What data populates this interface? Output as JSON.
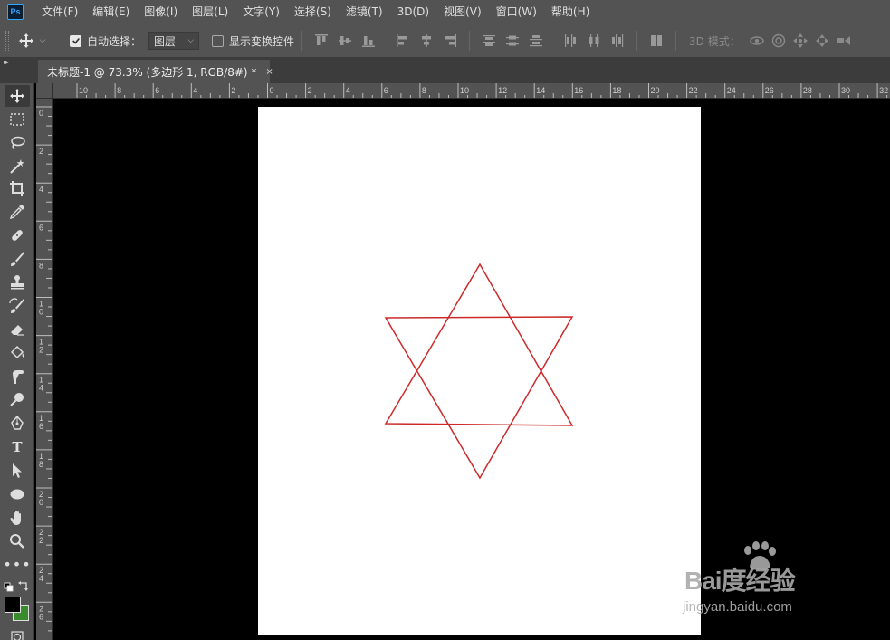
{
  "app": {
    "logo_text": "Ps"
  },
  "menu": [
    {
      "label": "文件(F)"
    },
    {
      "label": "编辑(E)"
    },
    {
      "label": "图像(I)"
    },
    {
      "label": "图层(L)"
    },
    {
      "label": "文字(Y)"
    },
    {
      "label": "选择(S)"
    },
    {
      "label": "滤镜(T)"
    },
    {
      "label": "3D(D)"
    },
    {
      "label": "视图(V)"
    },
    {
      "label": "窗口(W)"
    },
    {
      "label": "帮助(H)"
    }
  ],
  "options": {
    "auto_select_label": "自动选择：",
    "auto_select_checked": true,
    "auto_select_target": "图层",
    "show_transform_label": "显示变换控件",
    "show_transform_checked": false,
    "mode_3d_label": "3D 模式："
  },
  "document_tab": {
    "title": "未标题-1 @ 73.3% (多边形 1, RGB/8#) *",
    "close": "×"
  },
  "ruler": {
    "horizontal_labels": [
      "10",
      "8",
      "6",
      "4",
      "2",
      "0",
      "2",
      "4",
      "6",
      "8",
      "10",
      "12",
      "14",
      "16",
      "18",
      "20",
      "22",
      "24",
      "26",
      "28",
      "30",
      "32"
    ],
    "vertical_labels": [
      "0",
      "2",
      "4",
      "6",
      "8",
      "10",
      "12",
      "14",
      "16",
      "18",
      "20",
      "22",
      "24",
      "26"
    ]
  },
  "canvas": {
    "background": "#000000",
    "document_fill": "#ffffff",
    "shape": {
      "type": "hexagram",
      "stroke_color": "#cc2a2a"
    }
  },
  "colors": {
    "foreground": "#000000",
    "background": "#3a8a2e",
    "accent": "#31a8ff"
  },
  "watermark": {
    "logo": "Bai度经验",
    "url": "jingyan.baidu.com"
  }
}
